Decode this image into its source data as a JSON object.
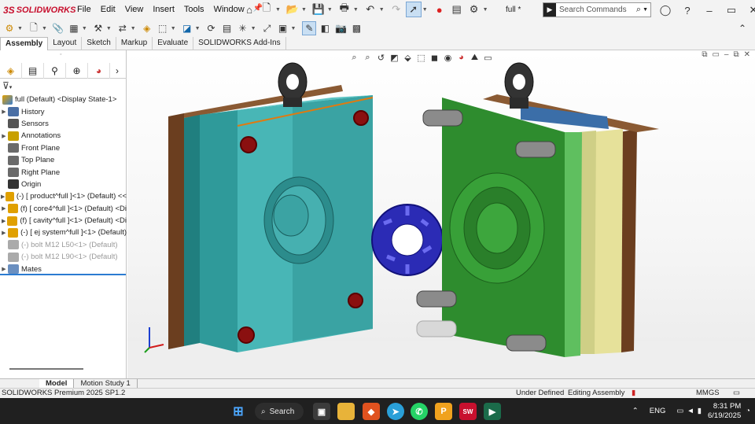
{
  "app": {
    "logo_text": "SOLIDWORKS",
    "logo_prefix": "3S",
    "doc_name": "full *"
  },
  "menu": [
    "File",
    "Edit",
    "View",
    "Insert",
    "Tools",
    "Window"
  ],
  "search": {
    "placeholder": "Search Commands"
  },
  "tabs": [
    "Assembly",
    "Layout",
    "Sketch",
    "Markup",
    "Evaluate",
    "SOLIDWORKS Add-Ins"
  ],
  "active_tab": "Assembly",
  "tree": {
    "root": "full (Default) <Display State-1>",
    "items": [
      {
        "label": "History",
        "expandable": true,
        "dim": false
      },
      {
        "label": "Sensors",
        "expandable": false,
        "dim": false
      },
      {
        "label": "Annotations",
        "expandable": true,
        "dim": false
      },
      {
        "label": "Front Plane",
        "expandable": false,
        "dim": false
      },
      {
        "label": "Top Plane",
        "expandable": false,
        "dim": false
      },
      {
        "label": "Right Plane",
        "expandable": false,
        "dim": false
      },
      {
        "label": "Origin",
        "expandable": false,
        "dim": false
      },
      {
        "label": "(-) [ product^full ]<1> (Default) <<",
        "expandable": true,
        "dim": false
      },
      {
        "label": "(f) [ core4^full ]<1> (Default) <Di",
        "expandable": true,
        "dim": false
      },
      {
        "label": "(f) [ cavity^full ]<1> (Default) <Di",
        "expandable": true,
        "dim": false
      },
      {
        "label": "(-) [ ej system^full ]<1> (Default)",
        "expandable": true,
        "dim": false
      },
      {
        "label": "(-) bolt M12 L50<1> (Default)",
        "expandable": false,
        "dim": true
      },
      {
        "label": "(-) bolt M12 L90<1> (Default)",
        "expandable": false,
        "dim": true
      },
      {
        "label": "Mates",
        "expandable": true,
        "dim": false
      }
    ]
  },
  "bottom_tabs": [
    "Model",
    "Motion Study 1"
  ],
  "status": {
    "left": "SOLIDWORKS Premium 2025 SP1.2",
    "state": "Under Defined",
    "mode": "Editing Assembly",
    "units": "MMGS"
  },
  "taskbar": {
    "search_label": "Search",
    "lang": "ENG",
    "time": "8:31 PM",
    "date": "6/19/2025"
  },
  "colors": {
    "accent_red": "#c8102e",
    "selection_blue": "#2b7bd1",
    "cavity_teal": "#3aa3a3",
    "core_green": "#2f8f2f"
  }
}
